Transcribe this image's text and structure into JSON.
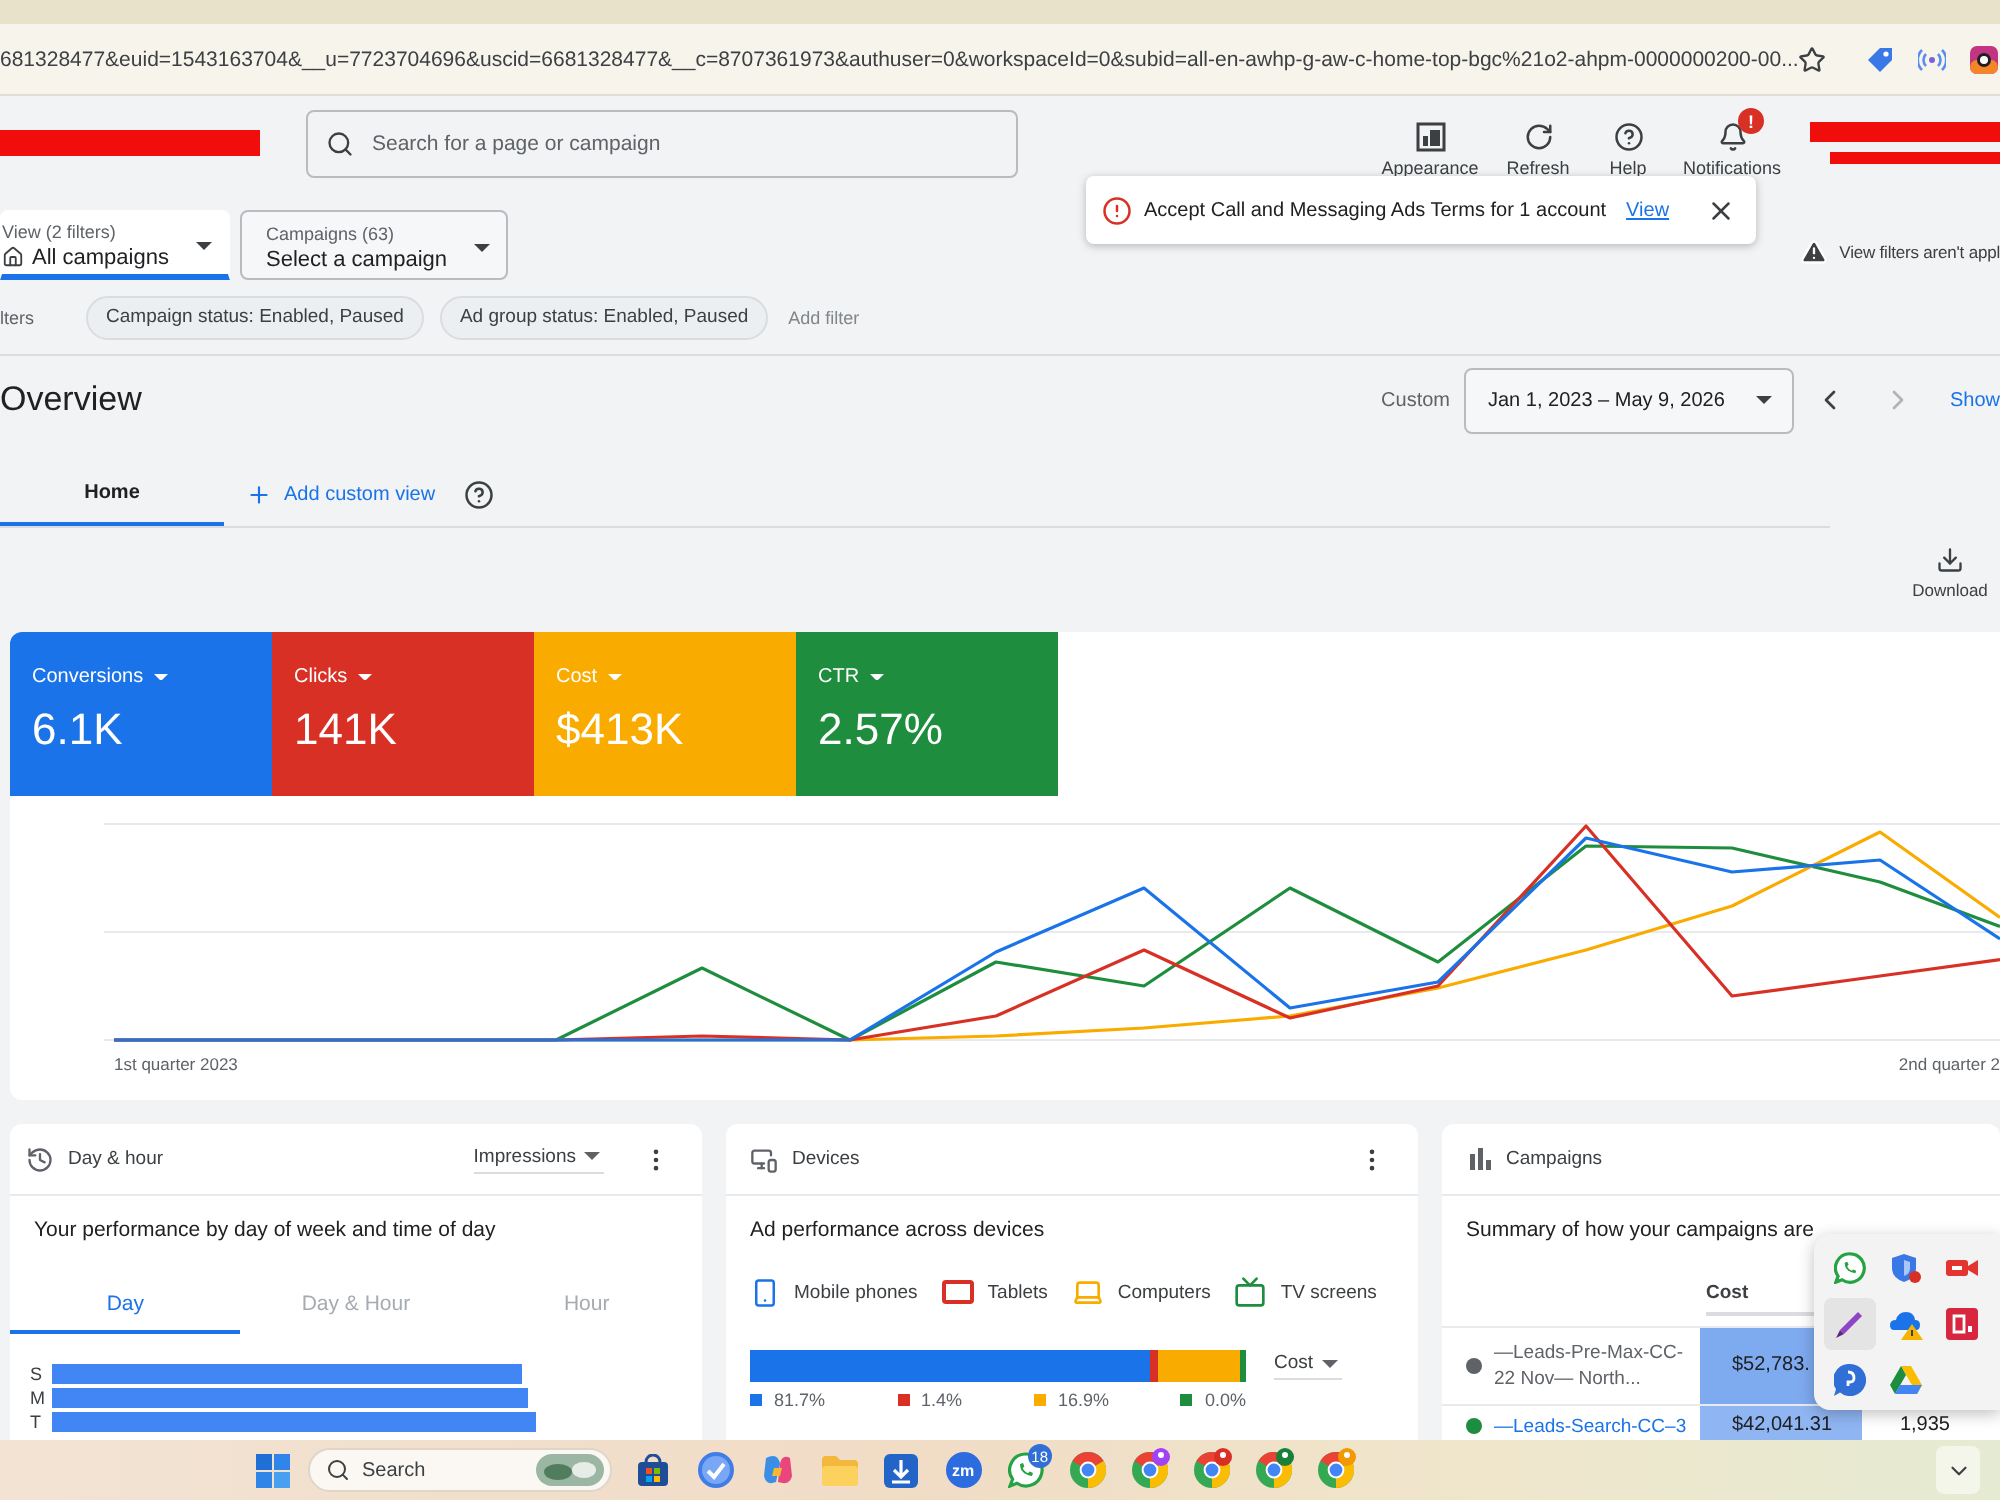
{
  "browser": {
    "url": "681328477&euid=1543163704&__u=7723704696&uscid=6681328477&__c=8707361973&authuser=0&workspaceId=0&subid=all-en-awhp-g-aw-c-home-top-bgc%21o2-ahpm-0000000200-00..."
  },
  "header": {
    "search": {
      "placeholder": "Search for a page or campaign"
    },
    "actions": [
      {
        "kind": "appearance",
        "label": "Appearance"
      },
      {
        "kind": "refresh",
        "label": "Refresh"
      },
      {
        "kind": "help",
        "label": "Help"
      },
      {
        "kind": "notifications",
        "label": "Notifications",
        "badge": "!"
      }
    ]
  },
  "selectors": [
    {
      "label": "View (2 filters)",
      "value": "All campaigns",
      "selected": true
    },
    {
      "label": "Campaigns (63)",
      "value": "Select a campaign",
      "selected": false
    }
  ],
  "toast": {
    "message": "Accept Call and Messaging Ads Terms for 1 account",
    "link": "View"
  },
  "notice": "View filters aren't appl",
  "filters": {
    "label": "lters",
    "chips": [
      "Campaign status: Enabled, Paused",
      "Ad group status: Enabled, Paused"
    ],
    "add": "Add filter"
  },
  "overview": {
    "title": "Overview",
    "range_label": "Custom",
    "date_range": "Jan 1, 2023 – May 9, 2026",
    "show": "Show"
  },
  "tabs": [
    {
      "label": "Home",
      "selected": true
    }
  ],
  "add_view": "Add custom view",
  "download": "Download",
  "metrics": [
    {
      "label": "Conversions",
      "value": "6.1K",
      "color": "#1a73e8"
    },
    {
      "label": "Clicks",
      "value": "141K",
      "color": "#d93025"
    },
    {
      "label": "Cost",
      "value": "$413K",
      "color": "#f9ab00"
    },
    {
      "label": "CTR",
      "value": "2.57%",
      "color": "#1e8e3e"
    }
  ],
  "trend": {
    "x_labels": [
      "1st quarter 2023",
      "2nd quarter 2"
    ]
  },
  "day_hour": {
    "title": "Day & hour",
    "metric": "Impressions",
    "subtitle": "Your performance by day of week and time of day",
    "tabs": [
      {
        "label": "Day",
        "selected": true
      },
      {
        "label": "Day & Hour",
        "selected": false
      },
      {
        "label": "Hour",
        "selected": false
      }
    ],
    "days": [
      "S",
      "M",
      "T"
    ]
  },
  "devices": {
    "title": "Devices",
    "subtitle": "Ad performance across devices",
    "metric": "Cost",
    "segments": [
      {
        "name": "Mobile phones",
        "color": "#1a73e8",
        "reading": "81.7%"
      },
      {
        "name": "Tablets",
        "color": "#d93025",
        "reading": "1.4%"
      },
      {
        "name": "Computers",
        "color": "#f9ab00",
        "reading": "16.9%"
      },
      {
        "name": "TV screens",
        "color": "#1e8e3e",
        "reading": "0.0%"
      }
    ]
  },
  "campaigns": {
    "title": "Campaigns",
    "subtitle": "Summary of how your campaigns are",
    "columns": [
      "Cost"
    ],
    "rows": [
      {
        "name": "—Leads-Pre-Max-CC-22 Nov— North...",
        "color": "#5f6368",
        "paused": true,
        "cells": [
          "$52,783."
        ]
      },
      {
        "name": "—Leads-Search-CC–3",
        "color": "#1e8e3e",
        "paused": false,
        "cells": [
          "$42,041.31",
          "1,935"
        ]
      }
    ]
  },
  "taskbar": {
    "search": {
      "placeholder": "Search"
    },
    "app_logo_text": "zm",
    "message_badge": "18"
  }
}
